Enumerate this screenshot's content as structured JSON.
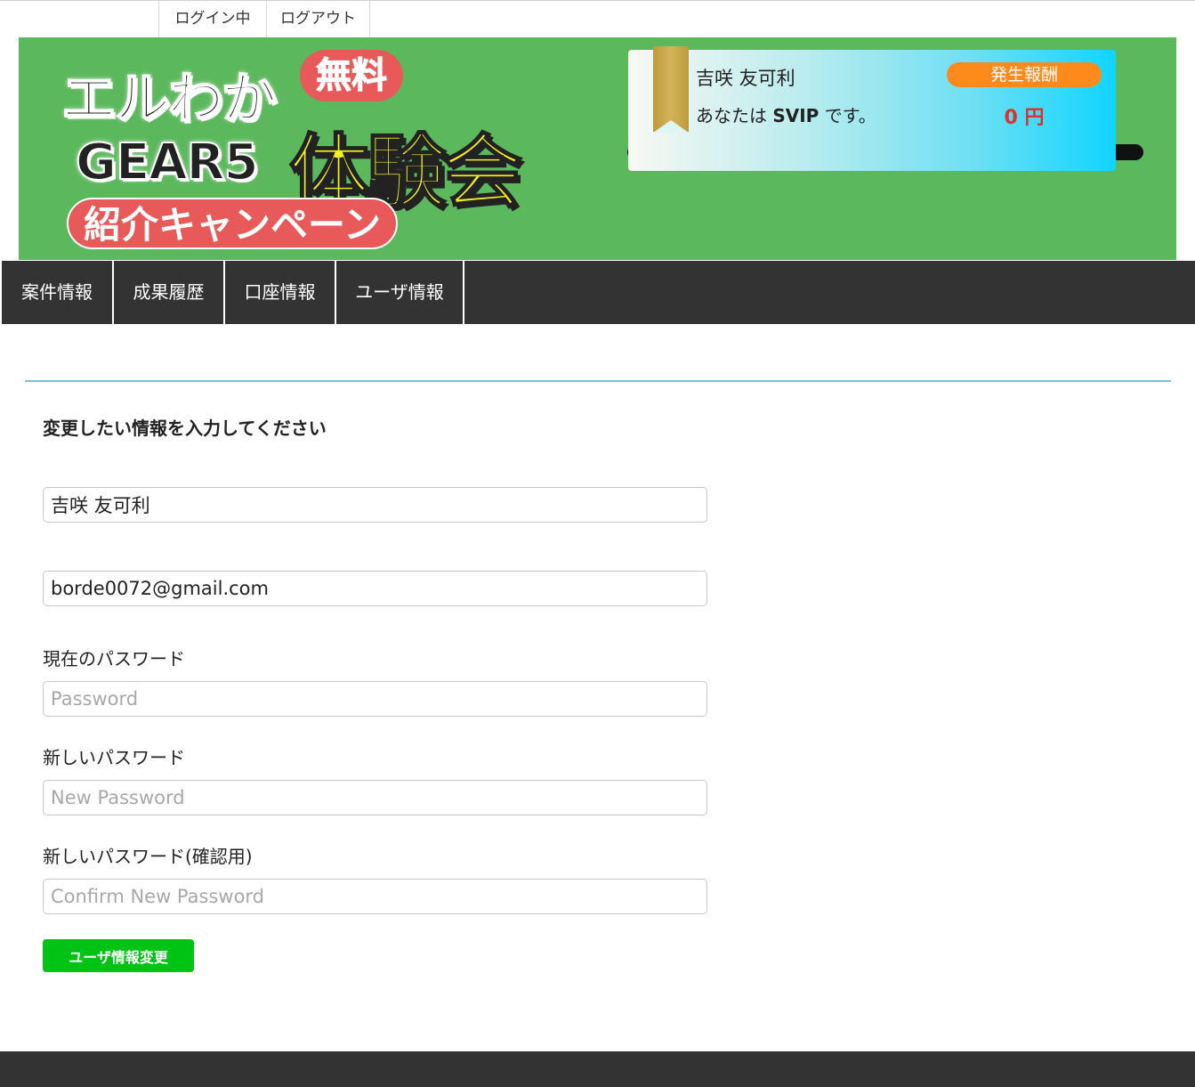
{
  "topbar": {
    "logged_in": "ログイン中",
    "logout": "ログアウト"
  },
  "banner": {
    "line1": "エルわか",
    "badge_free": "無料",
    "line2": "GEAR5",
    "headline": "体験会",
    "campaign": "紹介キャンペーン"
  },
  "user_card": {
    "name": "吉咲 友可利",
    "status_prefix": "あなたは",
    "rank": "SVIP",
    "status_suffix": "です。",
    "reward_label": "発生報酬",
    "reward_amount": "0 円"
  },
  "nav": {
    "items": [
      "案件情報",
      "成果履歴",
      "口座情報",
      "ユーザ情報"
    ]
  },
  "form": {
    "title": "変更したい情報を入力してください",
    "name_value": "吉咲 友可利",
    "email_value": "borde0072@gmail.com",
    "current_password_label": "現在のパスワード",
    "current_password_placeholder": "Password",
    "new_password_label": "新しいパスワード",
    "new_password_placeholder": "New Password",
    "confirm_password_label": "新しいパスワード(確認用)",
    "confirm_password_placeholder": "Confirm New Password",
    "submit_label": "ユーザ情報変更"
  },
  "colors": {
    "banner_green": "#5cb85c",
    "nav_dark": "#333333",
    "submit_green": "#00c314",
    "divider_blue": "#76c4dc",
    "reward_orange": "#ff8a1c",
    "reward_red": "#e0302c"
  }
}
